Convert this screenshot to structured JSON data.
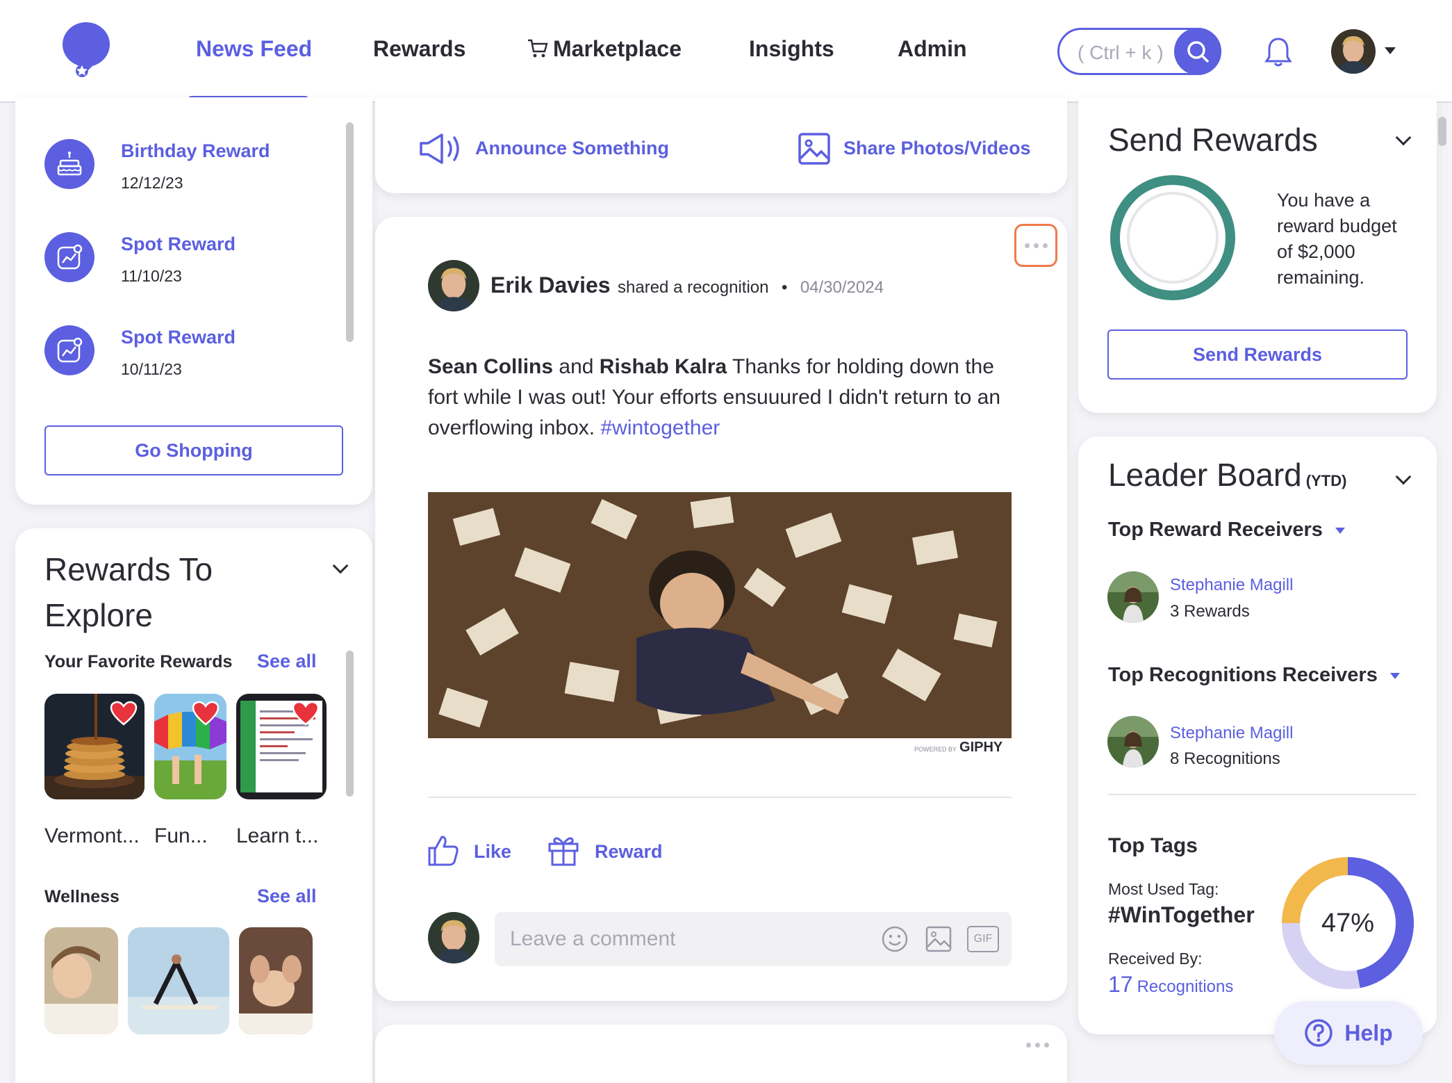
{
  "nav": {
    "items": [
      "News Feed",
      "Rewards",
      "Marketplace",
      "Insights",
      "Admin"
    ],
    "active": "News Feed",
    "search_placeholder": "( Ctrl + k )"
  },
  "recent_rewards": {
    "items": [
      {
        "title": "Birthday Reward",
        "date": "12/12/23",
        "icon": "cake-icon"
      },
      {
        "title": "Spot Reward",
        "date": "11/10/23",
        "icon": "chart-badge-icon"
      },
      {
        "title": "Spot Reward",
        "date": "10/11/23",
        "icon": "chart-badge-icon"
      }
    ],
    "button": "Go Shopping"
  },
  "explore": {
    "title_line1": "Rewards To",
    "title_line2": "Explore",
    "favorites_heading": "Your Favorite Rewards",
    "see_all": "See all",
    "favorites": [
      {
        "label": "Vermont..."
      },
      {
        "label": "Fun..."
      },
      {
        "label": "Learn t..."
      }
    ],
    "wellness_heading": "Wellness",
    "wellness_see_all": "See all"
  },
  "composer": {
    "announce": "Announce Something",
    "share": "Share Photos/Videos"
  },
  "post": {
    "author": "Erik Davies",
    "action": "shared a recognition",
    "separator": "•",
    "date": "04/30/2024",
    "recipient1": "Sean Collins",
    "conjunction": "and",
    "recipient2": "Rishab Kalra",
    "message": "Thanks for holding down the fort while I was out! Your efforts ensuuured I didn't return to an overflowing inbox.",
    "hashtag": "#wintogether",
    "giphy_powered": "POWERED BY",
    "giphy_brand": "GIPHY",
    "like_label": "Like",
    "reward_label": "Reward",
    "comment_placeholder": "Leave a comment",
    "gif_label": "GIF"
  },
  "send_rewards": {
    "title": "Send Rewards",
    "budget_text": "You have a reward budget of $2,000 remaining.",
    "button": "Send Rewards"
  },
  "leaderboard": {
    "title": "Leader Board",
    "period": "(YTD)",
    "top_reward_heading": "Top Reward Receivers",
    "top_reward": {
      "name": "Stephanie Magill",
      "count": "3 Rewards"
    },
    "top_recog_heading": "Top Recognitions Receivers",
    "top_recog": {
      "name": "Stephanie Magill",
      "count": "8 Recognitions"
    }
  },
  "top_tags": {
    "title": "Top Tags",
    "most_used_label": "Most Used Tag:",
    "tag": "#WinTogether",
    "received_label": "Received By:",
    "count": "17",
    "count_unit": "Recognitions",
    "percent_text": "47%",
    "percent_value": 47,
    "colors": {
      "primary": "#5b5fe0",
      "secondary": "#d6d2f4",
      "tertiary": "#f2b84b"
    }
  },
  "help": {
    "label": "Help"
  },
  "colors": {
    "accent": "#5b5fe0",
    "budget_ring": "#3f8f82",
    "more_border": "#f07a4a"
  }
}
